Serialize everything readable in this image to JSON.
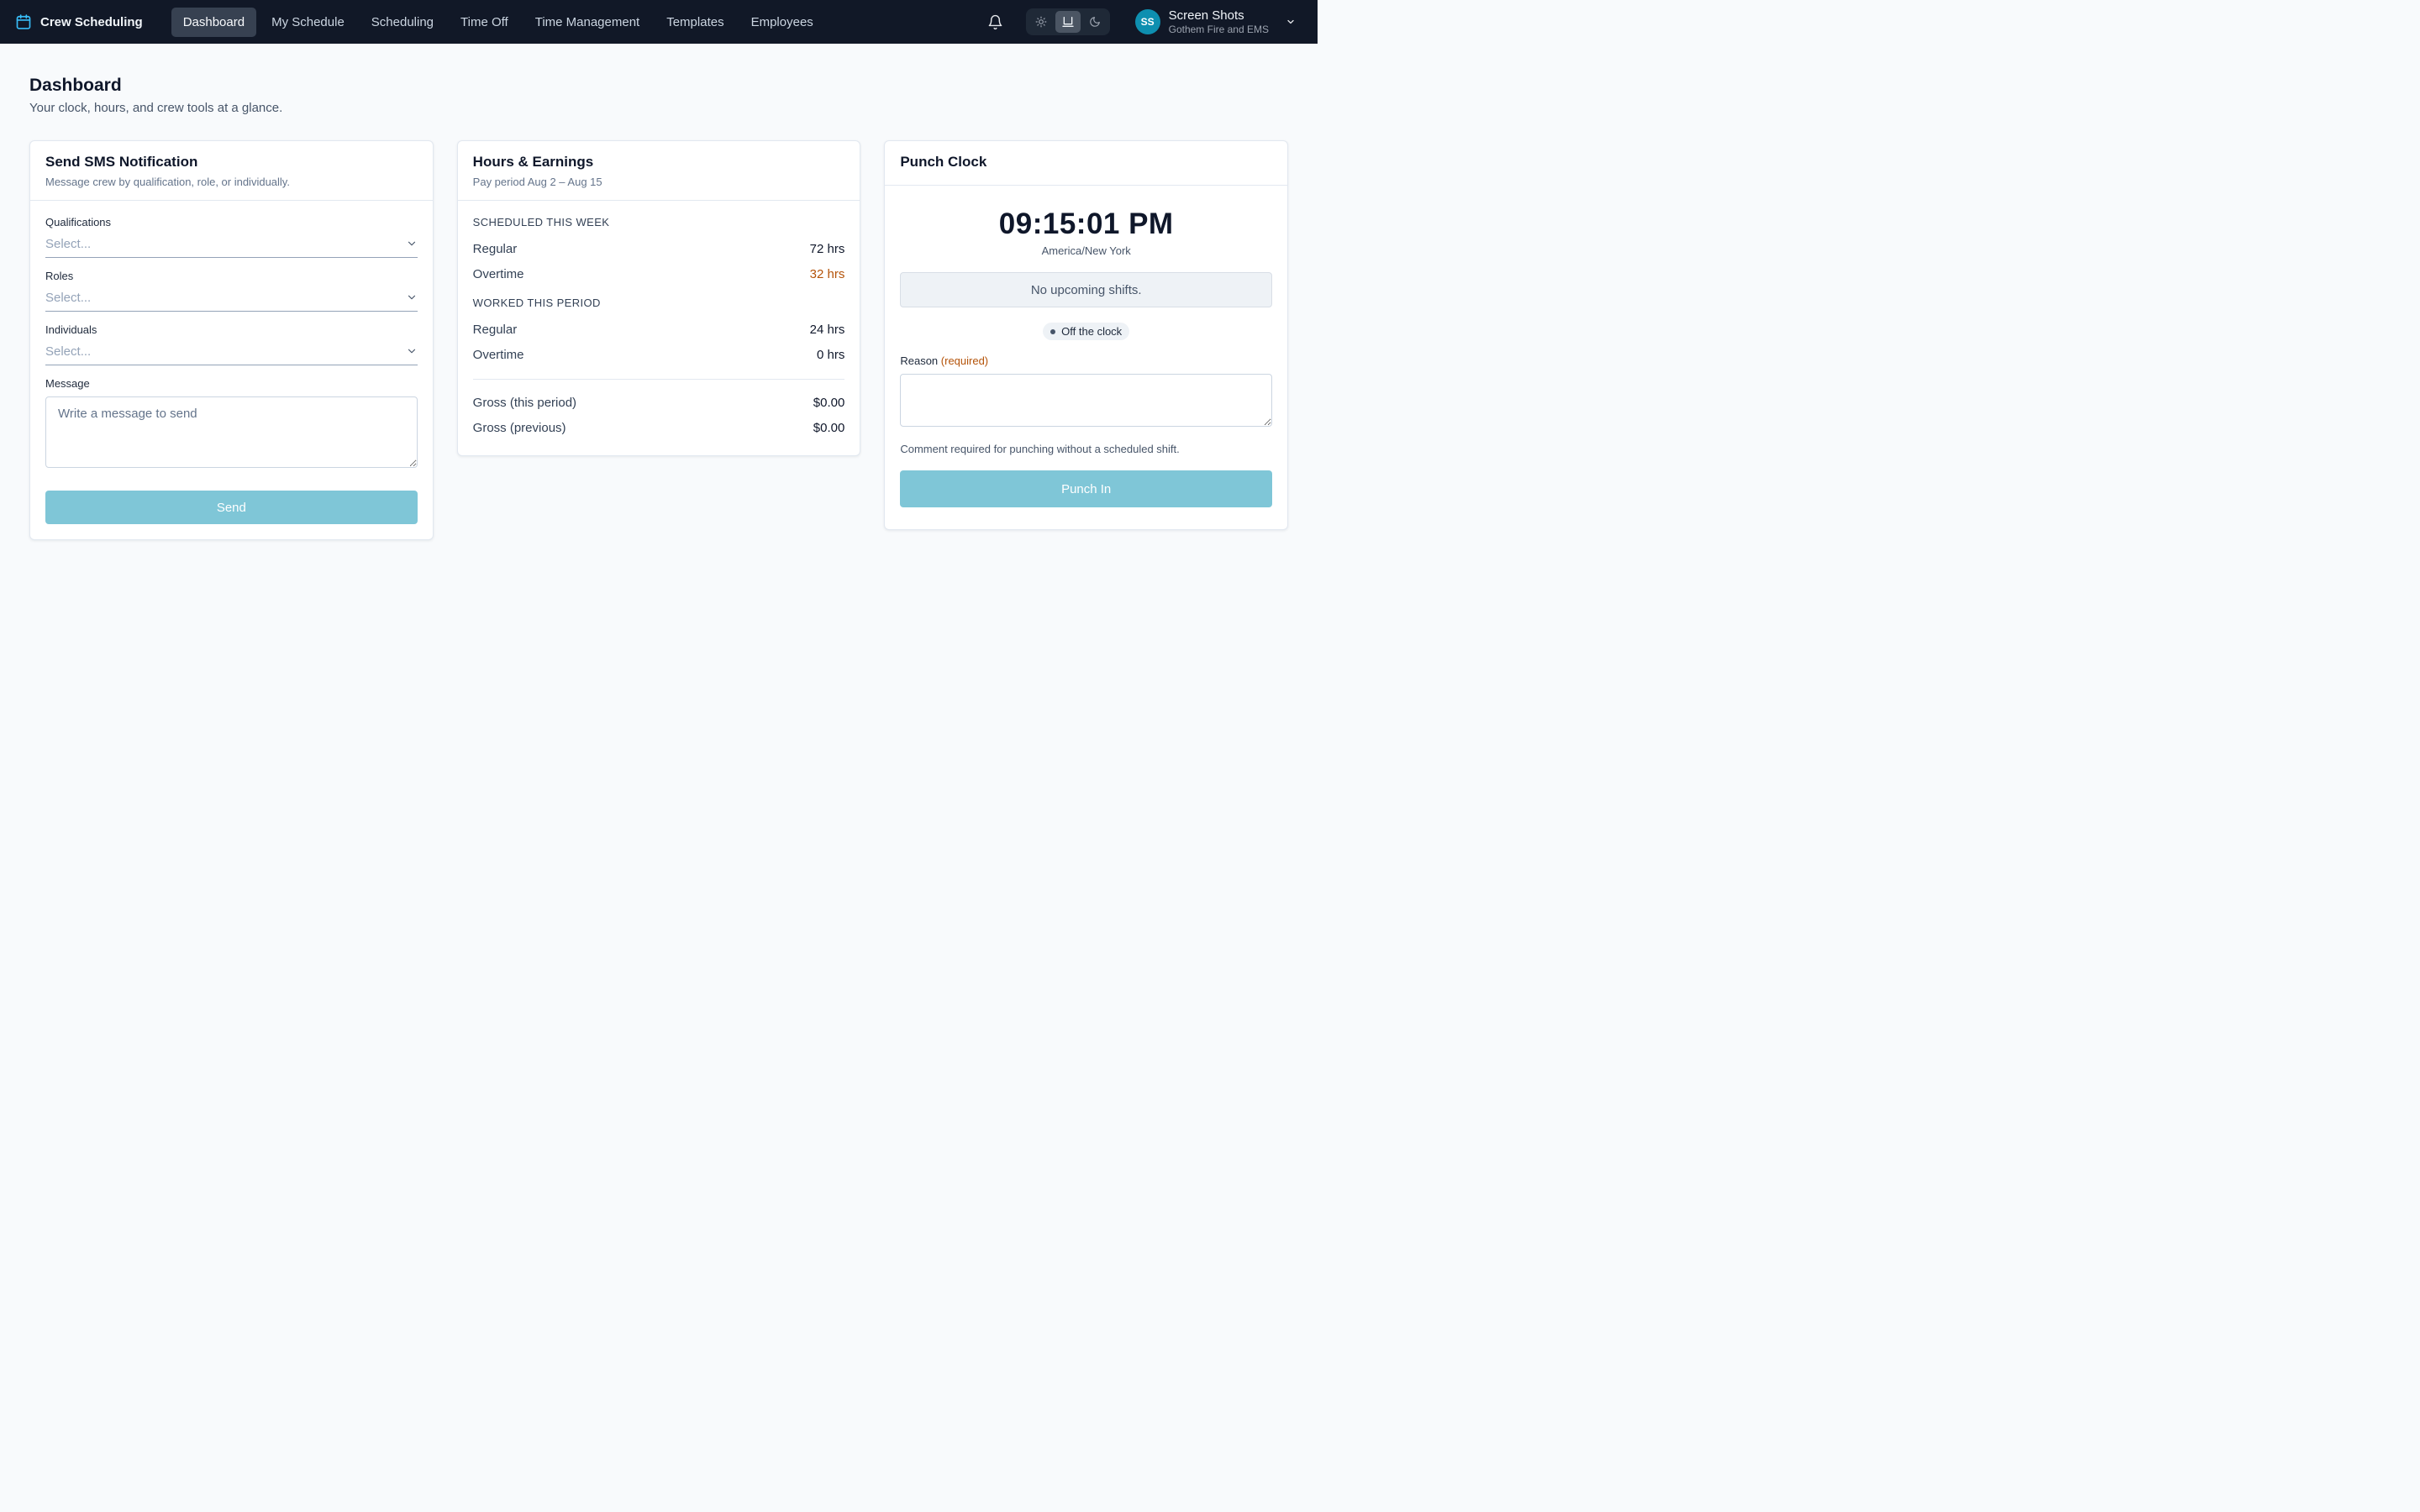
{
  "app": {
    "name": "Crew Scheduling"
  },
  "nav": {
    "items": [
      {
        "label": "Dashboard",
        "active": true
      },
      {
        "label": "My Schedule"
      },
      {
        "label": "Scheduling"
      },
      {
        "label": "Time Off"
      },
      {
        "label": "Time Management"
      },
      {
        "label": "Templates"
      },
      {
        "label": "Employees"
      }
    ]
  },
  "header": {
    "theme_options": [
      "light",
      "system",
      "dark"
    ],
    "theme_selected": "system",
    "user": {
      "initials": "SS",
      "name": "Screen Shots",
      "org": "Gothem Fire and EMS"
    }
  },
  "page": {
    "title": "Dashboard",
    "subtitle": "Your clock, hours, and crew tools at a glance."
  },
  "sms": {
    "title": "Send SMS Notification",
    "subtitle": "Message crew by qualification, role, or individually.",
    "qualifications_label": "Qualifications",
    "roles_label": "Roles",
    "individuals_label": "Individuals",
    "select_placeholder": "Select...",
    "message_label": "Message",
    "message_placeholder": "Write a message to send",
    "send_label": "Send"
  },
  "hours": {
    "title": "Hours & Earnings",
    "pay_period": "Pay period Aug 2 – Aug 15",
    "scheduled_label": "SCHEDULED THIS WEEK",
    "scheduled_regular_label": "Regular",
    "scheduled_regular": "72 hrs",
    "scheduled_overtime_label": "Overtime",
    "scheduled_overtime": "32 hrs",
    "worked_label": "WORKED THIS PERIOD",
    "worked_regular_label": "Regular",
    "worked_regular": "24 hrs",
    "worked_overtime_label": "Overtime",
    "worked_overtime": "0 hrs",
    "gross_this_label": "Gross (this period)",
    "gross_this": "$0.00",
    "gross_prev_label": "Gross (previous)",
    "gross_prev": "$0.00"
  },
  "punch": {
    "title": "Punch Clock",
    "time": "09:15:01 PM",
    "timezone": "America/New York",
    "shift_status": "No upcoming shifts.",
    "clock_status": "Off the clock",
    "reason_label": "Reason",
    "reason_required": "(required)",
    "help_text": "Comment required for punching without a scheduled shift.",
    "button_label": "Punch In"
  },
  "colors": {
    "topbar": "#111827",
    "accent": "#0e8fb0",
    "button_disabled": "#7fc6d7",
    "overtime": "#b45309"
  }
}
